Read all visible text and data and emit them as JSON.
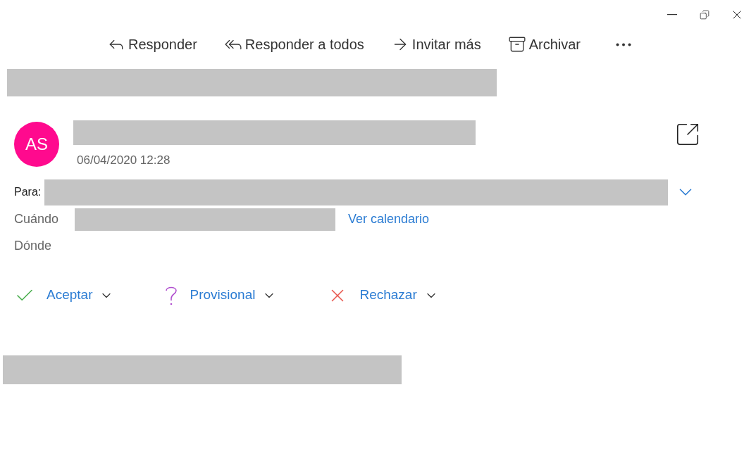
{
  "toolbar": [
    {
      "kind": "reply",
      "label": "Responder"
    },
    {
      "kind": "reply_all",
      "label": "Responder a todos"
    },
    {
      "kind": "forward",
      "label": "Invitar más"
    },
    {
      "kind": "archive",
      "label": "Archivar"
    }
  ],
  "sender": {
    "initials": "AS",
    "date": "06/04/2020 12:28"
  },
  "fields": {
    "to_label": "Para:",
    "when_label": "Cuándo",
    "calendar_link": "Ver calendario",
    "where_label": "Dónde"
  },
  "responses": [
    {
      "kind": "accept",
      "label": "Aceptar"
    },
    {
      "kind": "tentative",
      "label": "Provisional"
    },
    {
      "kind": "decline",
      "label": "Rechazar"
    }
  ]
}
